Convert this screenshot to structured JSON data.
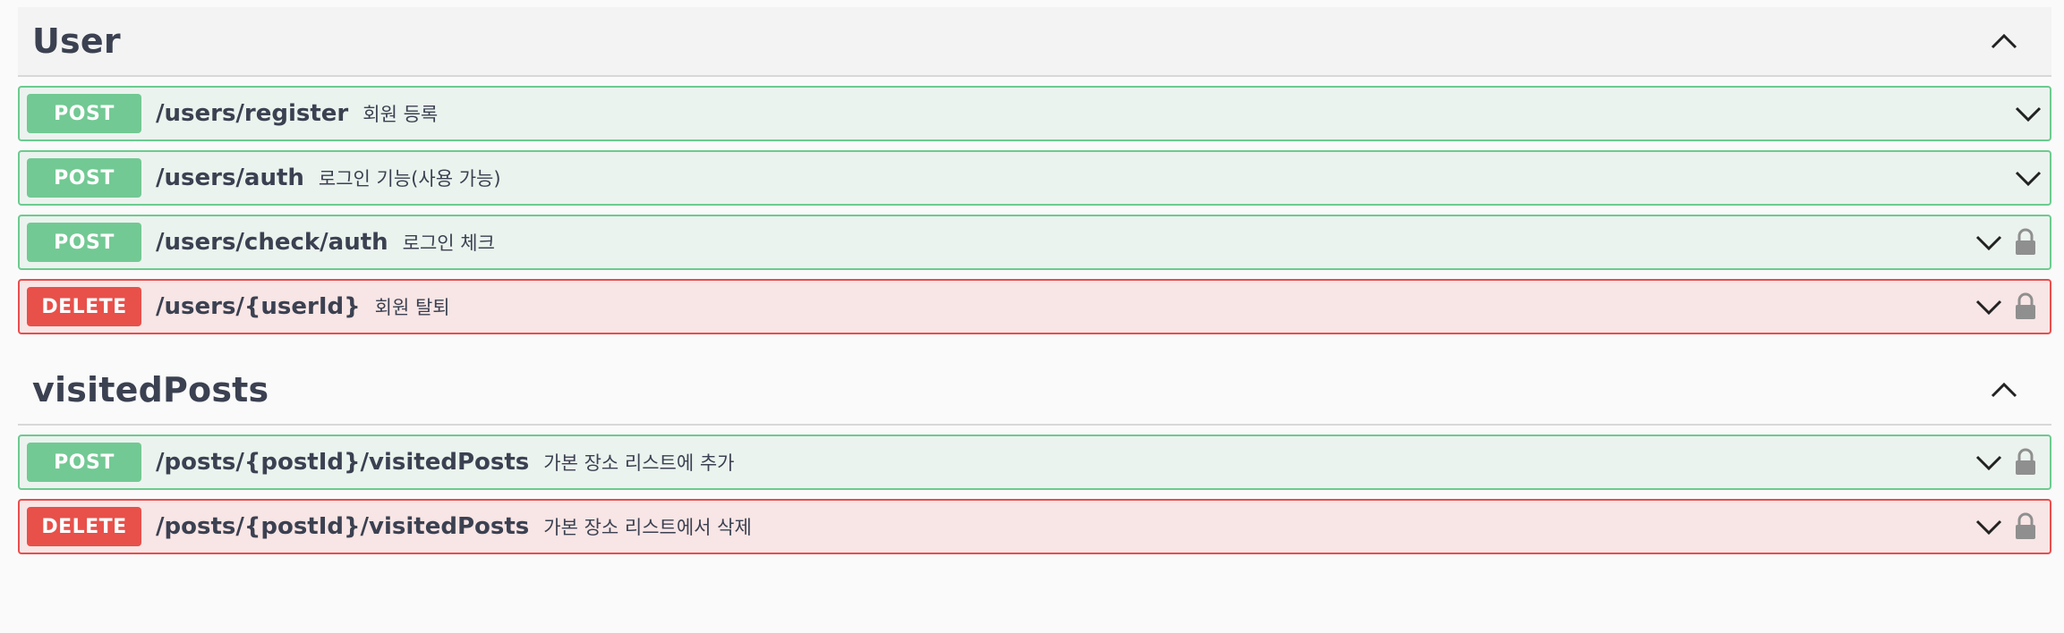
{
  "sections": [
    {
      "title": "User",
      "toggle_icon": "chevron-up-icon",
      "operations": [
        {
          "method": "POST",
          "path": "/users/register",
          "summary": "회원 등록",
          "locked": false
        },
        {
          "method": "POST",
          "path": "/users/auth",
          "summary": "로그인 기능(사용 가능)",
          "locked": false
        },
        {
          "method": "POST",
          "path": "/users/check/auth",
          "summary": "로그인 체크",
          "locked": true
        },
        {
          "method": "DELETE",
          "path": "/users/{userId}",
          "summary": "회원 탈퇴",
          "locked": true
        }
      ]
    },
    {
      "title": "visitedPosts",
      "toggle_icon": "chevron-up-icon",
      "operations": [
        {
          "method": "POST",
          "path": "/posts/{postId}/visitedPosts",
          "summary": "가본 장소 리스트에 추가",
          "locked": true
        },
        {
          "method": "DELETE",
          "path": "/posts/{postId}/visitedPosts",
          "summary": "가본 장소 리스트에서 삭제",
          "locked": true
        }
      ]
    }
  ],
  "colors": {
    "post": "#49cc90",
    "delete": "#f93e3e",
    "text": "#3b4151"
  }
}
